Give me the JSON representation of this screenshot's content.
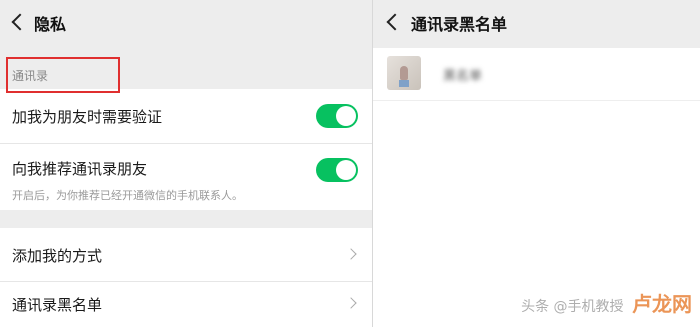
{
  "left_screen": {
    "nav": {
      "title": "隐私"
    },
    "section_label": "通讯录",
    "settings": [
      {
        "label": "加我为朋友时需要验证",
        "toggle_on": true
      },
      {
        "label": "向我推荐通讯录朋友",
        "sub": "开启后，为你推荐已经开通微信的手机联系人。",
        "toggle_on": true
      }
    ],
    "links": [
      {
        "label": "添加我的方式"
      },
      {
        "label": "通讯录黑名单"
      }
    ]
  },
  "right_screen": {
    "nav": {
      "title": "通讯录黑名单"
    },
    "contacts": [
      {
        "name": "黑名单"
      }
    ]
  },
  "watermark": {
    "text": "头条 @手机教授",
    "logo": "卢龙网"
  },
  "colors": {
    "toggle_on": "#07c160",
    "highlight_box": "#e02f2f",
    "background": "#ededed"
  }
}
